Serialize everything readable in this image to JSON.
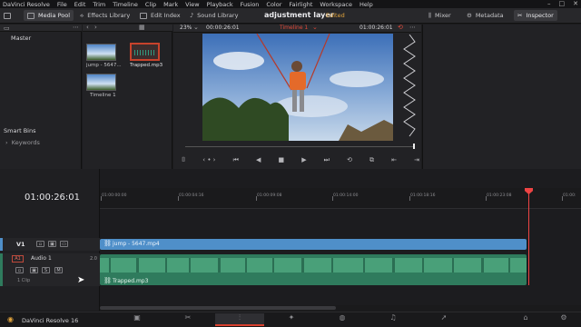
{
  "menubar": {
    "app": "DaVinci Resolve",
    "items": [
      "File",
      "Edit",
      "Trim",
      "Timeline",
      "Clip",
      "Mark",
      "View",
      "Playback",
      "Fusion",
      "Color",
      "Fairlight",
      "Workspace",
      "Help"
    ]
  },
  "toolbar": {
    "media_pool": "Media Pool",
    "effects_library": "Effects Library",
    "edit_index": "Edit Index",
    "sound_library": "Sound Library",
    "project_title": "adjustment layer",
    "project_status": "Edited",
    "mixer": "Mixer",
    "metadata": "Metadata",
    "inspector": "Inspector"
  },
  "media_pool": {
    "bin_master": "Master",
    "clips": [
      {
        "name": "jump - 5647..."
      },
      {
        "name": "Trapped.mp3"
      },
      {
        "name": "Timeline 1"
      }
    ],
    "smart_bins": "Smart Bins",
    "keywords": "Keywords"
  },
  "viewer": {
    "zoom": "23%",
    "source_tc": "00:00:26:01",
    "timeline_name": "Timeline 1",
    "record_tc": "01:00:26:01"
  },
  "timeline": {
    "timecode": "01:00:26:01",
    "ruler": [
      "01:00:00:00",
      "01:00:04:16",
      "01:00:09:08",
      "01:00:14:00",
      "01:00:18:16",
      "01:00:23:08",
      "01:00:"
    ],
    "tracks": {
      "v1": {
        "id": "V1",
        "clip": "jump - 5647.mp4"
      },
      "a1": {
        "id": "A1",
        "name": "Audio 1",
        "level": "2.0",
        "clip_count": "1 Clip",
        "clip": "Trapped.mp3",
        "solo": "S",
        "mute": "M"
      }
    }
  },
  "footer": {
    "app_version": "DaVinci Resolve 16"
  },
  "colors": {
    "accent_red": "#d8402e",
    "video_clip": "#4f8fc9",
    "audio_clip": "#2f7b5d",
    "edited": "#e0a33c"
  }
}
